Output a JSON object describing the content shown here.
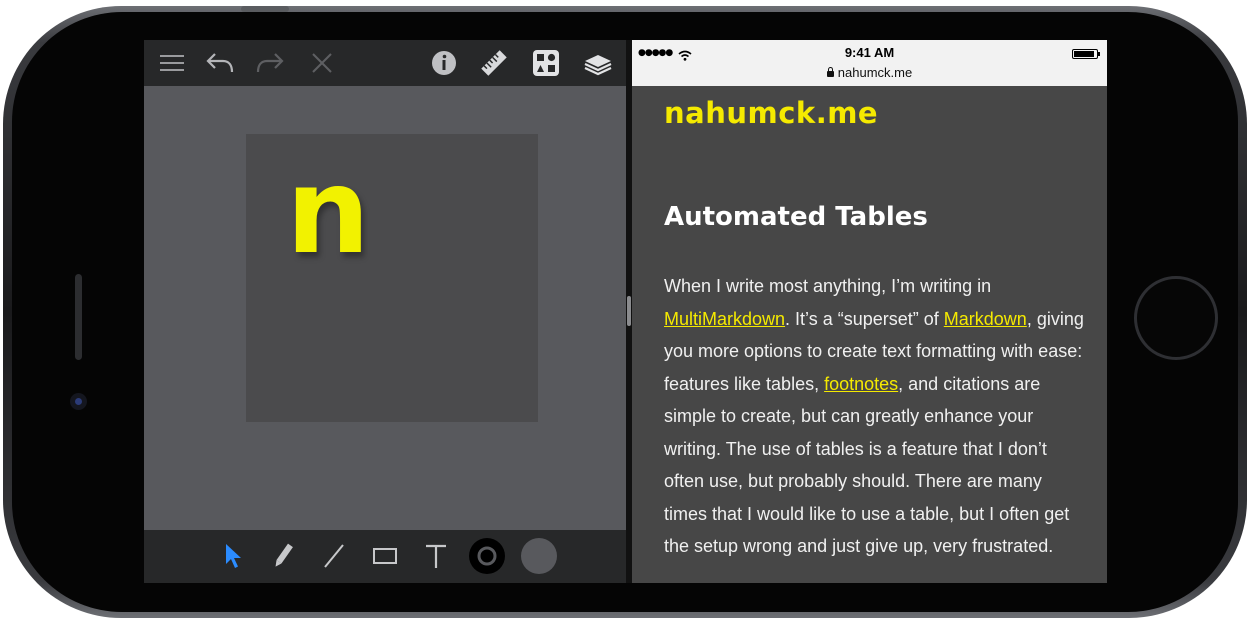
{
  "left_app": {
    "toolbar": {
      "icons": [
        "menu-icon",
        "undo-icon",
        "redo-icon",
        "close-icon",
        "info-icon",
        "ruler-icon",
        "shapes-icon",
        "layers-icon"
      ]
    },
    "canvas": {
      "letter": "n",
      "letter_color": "#f2f200",
      "card_color": "#4b4b4d"
    },
    "bottom_tools": {
      "icons": [
        "pointer-icon",
        "pencil-icon",
        "line-icon",
        "rectangle-icon",
        "text-tool-icon",
        "stroke-color-icon",
        "fill-color-icon"
      ],
      "active": "pointer-icon",
      "active_color": "#2b8cff"
    }
  },
  "right_app": {
    "status_bar": {
      "time": "9:41 AM",
      "url": "nahumck.me"
    },
    "site_title": "nahumck.me",
    "article": {
      "title": "Automated Tables",
      "p1": "When I write most anything, I’m writing in ",
      "link_multimarkdown": "MultiMarkdown",
      "p2": ". It’s a “superset” of ",
      "link_markdown": "Markdown",
      "p3": ", giving you more options to create text formatting with ease: features like tables, ",
      "link_footnotes": "footnotes",
      "p4": ", and citations are simple to create, but can greatly enhance your writing. The use of tables is a feature that I don’t often use, but probably should. There are many times that I would like to use a table, but I often get the setup wrong and just give up, very frustrated."
    },
    "accent_color": "#f5ea00"
  }
}
